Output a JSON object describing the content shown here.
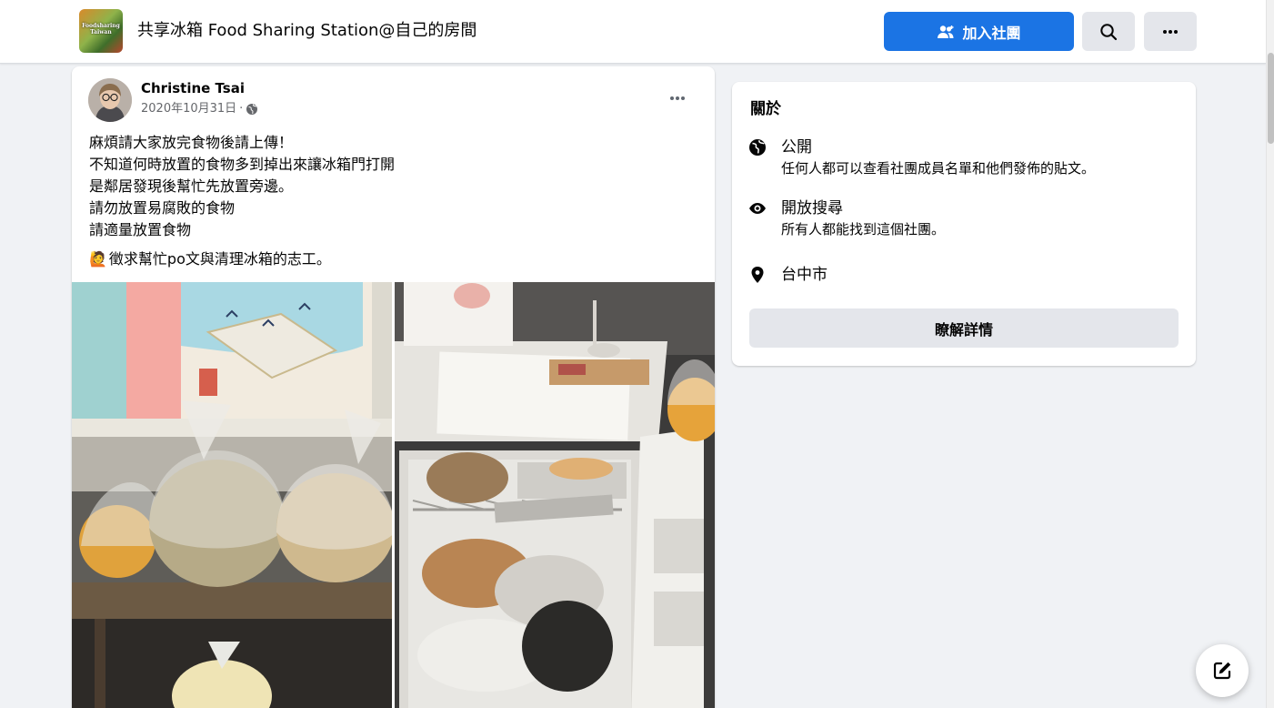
{
  "header": {
    "group_name": "共享冰箱 Food Sharing Station@自己的房間",
    "thumb_text": "Foodsharing Taiwan",
    "join_label": "加入社團",
    "search_icon": "search-icon",
    "more_icon": "more-icon",
    "accent_color": "#1b74e4"
  },
  "post": {
    "author": "Christine Tsai",
    "date": "2020年10月31日",
    "separator": "·",
    "privacy_icon": "globe-icon",
    "lines": [
      "麻煩請大家放完食物後請上傳！",
      "不知道何時放置的食物多到掉出來讓冰箱門打開",
      "是鄰居發現後幫忙先放置旁邊。",
      "請勿放置易腐敗的食物",
      "請適量放置食物"
    ],
    "extra_emoji": "🙋",
    "extra_line": "徵求幫忙po文與清理冰箱的志工。",
    "photos": [
      "photo-shelf-bags",
      "photo-open-fridge"
    ]
  },
  "about": {
    "title": "關於",
    "items": [
      {
        "icon": "globe-icon",
        "title": "公開",
        "subtitle": "任何人都可以查看社團成員名單和他們發佈的貼文。"
      },
      {
        "icon": "eye-icon",
        "title": "開放搜尋",
        "subtitle": "所有人都能找到這個社團。"
      },
      {
        "icon": "location-pin-icon",
        "title": "台中市",
        "subtitle": ""
      }
    ],
    "learn_more_label": "瞭解詳情"
  },
  "compose_icon": "compose-icon"
}
